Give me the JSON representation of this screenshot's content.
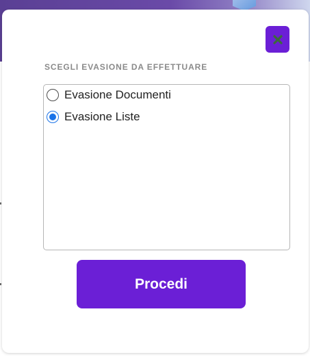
{
  "dialog": {
    "section_label": "SCEGLI EVASIONE DA EFFETTUARE",
    "options": [
      {
        "label": "Evasione Documenti",
        "selected": false
      },
      {
        "label": "Evasione Liste",
        "selected": true
      }
    ],
    "proceed_label": "Procedi",
    "close_icon": "close-icon"
  },
  "colors": {
    "accent": "#6b1fd6",
    "radio_selected": "#1a73e8",
    "label_gray": "#8a8a8a",
    "close_x": "#3b6b3b"
  }
}
